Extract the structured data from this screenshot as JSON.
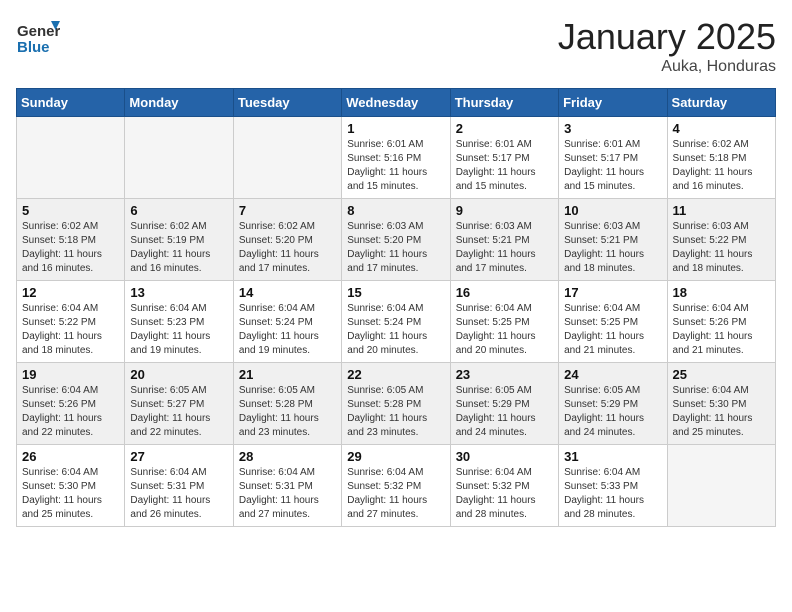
{
  "logo": {
    "general": "General",
    "blue": "Blue"
  },
  "title": {
    "month_year": "January 2025",
    "location": "Auka, Honduras"
  },
  "days_of_week": [
    "Sunday",
    "Monday",
    "Tuesday",
    "Wednesday",
    "Thursday",
    "Friday",
    "Saturday"
  ],
  "weeks": [
    [
      {
        "day": "",
        "empty": true
      },
      {
        "day": "",
        "empty": true
      },
      {
        "day": "",
        "empty": true
      },
      {
        "day": "1",
        "sunrise": "6:01 AM",
        "sunset": "5:16 PM",
        "daylight": "11 hours and 15 minutes."
      },
      {
        "day": "2",
        "sunrise": "6:01 AM",
        "sunset": "5:17 PM",
        "daylight": "11 hours and 15 minutes."
      },
      {
        "day": "3",
        "sunrise": "6:01 AM",
        "sunset": "5:17 PM",
        "daylight": "11 hours and 15 minutes."
      },
      {
        "day": "4",
        "sunrise": "6:02 AM",
        "sunset": "5:18 PM",
        "daylight": "11 hours and 16 minutes."
      }
    ],
    [
      {
        "day": "5",
        "sunrise": "6:02 AM",
        "sunset": "5:18 PM",
        "daylight": "11 hours and 16 minutes."
      },
      {
        "day": "6",
        "sunrise": "6:02 AM",
        "sunset": "5:19 PM",
        "daylight": "11 hours and 16 minutes."
      },
      {
        "day": "7",
        "sunrise": "6:02 AM",
        "sunset": "5:20 PM",
        "daylight": "11 hours and 17 minutes."
      },
      {
        "day": "8",
        "sunrise": "6:03 AM",
        "sunset": "5:20 PM",
        "daylight": "11 hours and 17 minutes."
      },
      {
        "day": "9",
        "sunrise": "6:03 AM",
        "sunset": "5:21 PM",
        "daylight": "11 hours and 17 minutes."
      },
      {
        "day": "10",
        "sunrise": "6:03 AM",
        "sunset": "5:21 PM",
        "daylight": "11 hours and 18 minutes."
      },
      {
        "day": "11",
        "sunrise": "6:03 AM",
        "sunset": "5:22 PM",
        "daylight": "11 hours and 18 minutes."
      }
    ],
    [
      {
        "day": "12",
        "sunrise": "6:04 AM",
        "sunset": "5:22 PM",
        "daylight": "11 hours and 18 minutes."
      },
      {
        "day": "13",
        "sunrise": "6:04 AM",
        "sunset": "5:23 PM",
        "daylight": "11 hours and 19 minutes."
      },
      {
        "day": "14",
        "sunrise": "6:04 AM",
        "sunset": "5:24 PM",
        "daylight": "11 hours and 19 minutes."
      },
      {
        "day": "15",
        "sunrise": "6:04 AM",
        "sunset": "5:24 PM",
        "daylight": "11 hours and 20 minutes."
      },
      {
        "day": "16",
        "sunrise": "6:04 AM",
        "sunset": "5:25 PM",
        "daylight": "11 hours and 20 minutes."
      },
      {
        "day": "17",
        "sunrise": "6:04 AM",
        "sunset": "5:25 PM",
        "daylight": "11 hours and 21 minutes."
      },
      {
        "day": "18",
        "sunrise": "6:04 AM",
        "sunset": "5:26 PM",
        "daylight": "11 hours and 21 minutes."
      }
    ],
    [
      {
        "day": "19",
        "sunrise": "6:04 AM",
        "sunset": "5:26 PM",
        "daylight": "11 hours and 22 minutes."
      },
      {
        "day": "20",
        "sunrise": "6:05 AM",
        "sunset": "5:27 PM",
        "daylight": "11 hours and 22 minutes."
      },
      {
        "day": "21",
        "sunrise": "6:05 AM",
        "sunset": "5:28 PM",
        "daylight": "11 hours and 23 minutes."
      },
      {
        "day": "22",
        "sunrise": "6:05 AM",
        "sunset": "5:28 PM",
        "daylight": "11 hours and 23 minutes."
      },
      {
        "day": "23",
        "sunrise": "6:05 AM",
        "sunset": "5:29 PM",
        "daylight": "11 hours and 24 minutes."
      },
      {
        "day": "24",
        "sunrise": "6:05 AM",
        "sunset": "5:29 PM",
        "daylight": "11 hours and 24 minutes."
      },
      {
        "day": "25",
        "sunrise": "6:04 AM",
        "sunset": "5:30 PM",
        "daylight": "11 hours and 25 minutes."
      }
    ],
    [
      {
        "day": "26",
        "sunrise": "6:04 AM",
        "sunset": "5:30 PM",
        "daylight": "11 hours and 25 minutes."
      },
      {
        "day": "27",
        "sunrise": "6:04 AM",
        "sunset": "5:31 PM",
        "daylight": "11 hours and 26 minutes."
      },
      {
        "day": "28",
        "sunrise": "6:04 AM",
        "sunset": "5:31 PM",
        "daylight": "11 hours and 27 minutes."
      },
      {
        "day": "29",
        "sunrise": "6:04 AM",
        "sunset": "5:32 PM",
        "daylight": "11 hours and 27 minutes."
      },
      {
        "day": "30",
        "sunrise": "6:04 AM",
        "sunset": "5:32 PM",
        "daylight": "11 hours and 28 minutes."
      },
      {
        "day": "31",
        "sunrise": "6:04 AM",
        "sunset": "5:33 PM",
        "daylight": "11 hours and 28 minutes."
      },
      {
        "day": "",
        "empty": true
      }
    ]
  ],
  "labels": {
    "sunrise": "Sunrise:",
    "sunset": "Sunset:",
    "daylight": "Daylight:"
  }
}
